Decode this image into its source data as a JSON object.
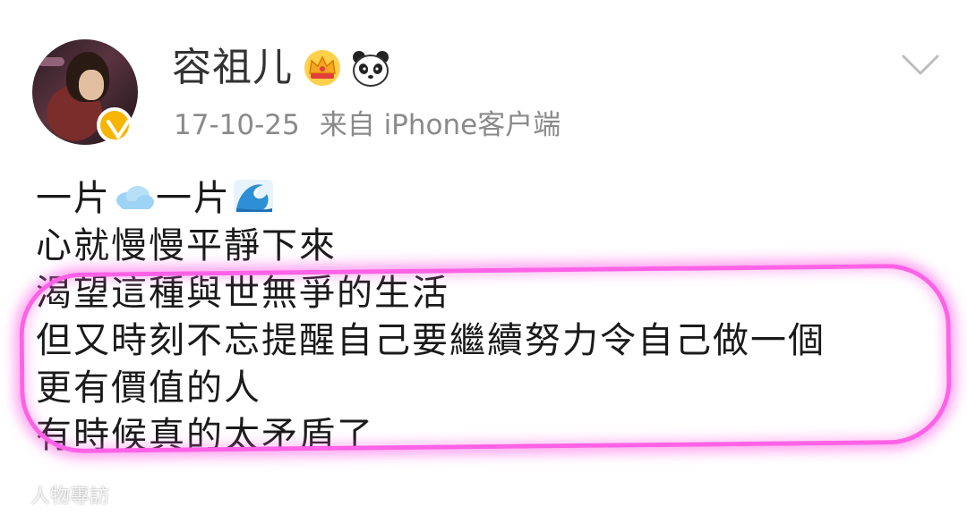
{
  "header": {
    "username": "容祖儿",
    "badges": [
      "crown-icon",
      "panda-icon"
    ],
    "verified_badge": "verified-v-icon",
    "more_menu_icon": "chevron-down-icon"
  },
  "meta": {
    "date": "17-10-25",
    "source": "来自 iPhone客户端"
  },
  "post": {
    "line1_a": "一片",
    "line1_b": "一片",
    "line1_icons": [
      "cloud-emoji",
      "wave-emoji"
    ],
    "lines": [
      "心就慢慢平靜下來",
      "渴望這種與世無爭的生活",
      "但又時刻不忘提醒自己要繼續努力令自己做一個",
      "更有價值的人",
      "有時候真的太矛盾了"
    ]
  },
  "watermark": {
    "text": "人物專訪"
  },
  "colors": {
    "highlight": "#ff62e6",
    "verified": "#f7b500",
    "meta_text": "#8a8a8a"
  }
}
